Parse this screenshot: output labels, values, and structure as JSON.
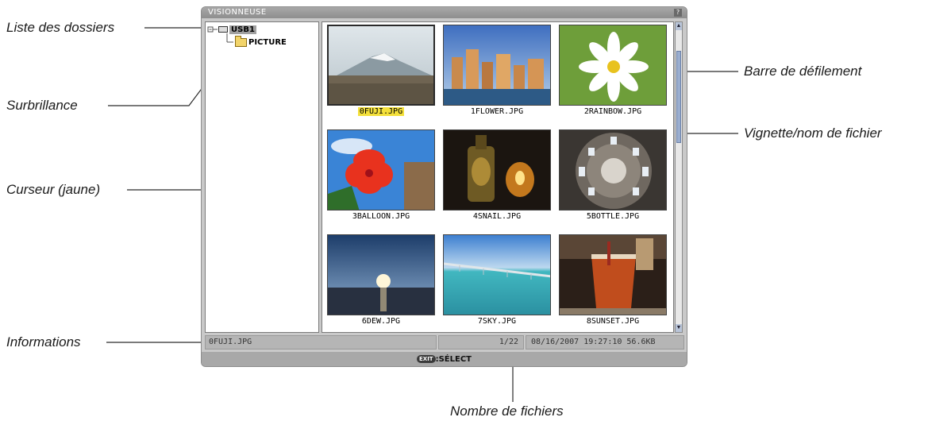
{
  "callouts": {
    "folder_list": "Liste des dossiers",
    "highlight": "Surbrillance",
    "cursor": "Curseur (jaune)",
    "information": "Informations",
    "scrollbar": "Barre de défilement",
    "thumbnail_filename": "Vignette/nom de fichier",
    "file_count": "Nombre de fichiers"
  },
  "window": {
    "title": "VISIONNEUSE",
    "help": "?"
  },
  "tree": {
    "drive": "USB1",
    "folder": "PICTURE"
  },
  "thumbnails": [
    {
      "name": "0FUJI.JPG",
      "selected": true
    },
    {
      "name": "1FLOWER.JPG"
    },
    {
      "name": "2RAINBOW.JPG"
    },
    {
      "name": "3BALLOON.JPG"
    },
    {
      "name": "4SNAIL.JPG"
    },
    {
      "name": "5BOTTLE.JPG"
    },
    {
      "name": "6DEW.JPG"
    },
    {
      "name": "7SKY.JPG"
    },
    {
      "name": "8SUNSET.JPG"
    }
  ],
  "scrollbar": {
    "up": "▲",
    "down": "▼"
  },
  "info": {
    "filename": "0FUJI.JPG",
    "count": "1/22",
    "datetime_size": "08/16/2007 19:27:10  56.6KB"
  },
  "footer": {
    "exit_key": "EXIT",
    "action": ":SÉLECT"
  },
  "colors": {
    "cursor": "#f4e03a",
    "highlight": "#a0a0a0"
  }
}
